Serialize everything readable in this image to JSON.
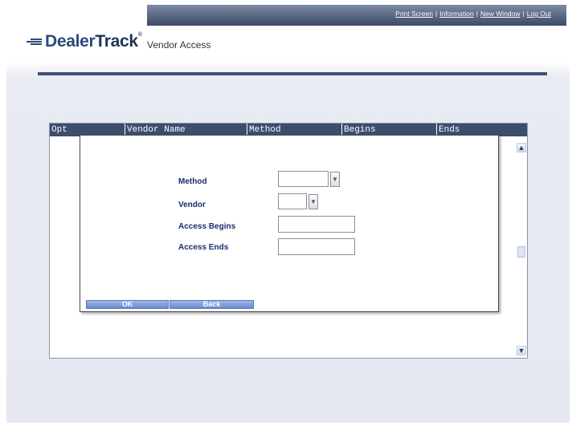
{
  "header": {
    "links": [
      "Print Screen",
      "Information",
      "New Window",
      "Log Out"
    ],
    "separator": "|",
    "brand": {
      "part1": "Dealer",
      "part2": "Track",
      "mark": "®"
    },
    "app_title": "Vendor Access"
  },
  "grid": {
    "columns": [
      "Opt",
      "Vendor Name",
      "Method",
      "Begins",
      "Ends"
    ],
    "scroll_up": "▲",
    "scroll_down": "▼"
  },
  "dialog": {
    "fields": [
      {
        "label": "Method",
        "value": ""
      },
      {
        "label": "Vendor",
        "value": ""
      },
      {
        "label": "Access Begins",
        "value": ""
      },
      {
        "label": "Access Ends",
        "value": ""
      }
    ],
    "dropdown_arrow": "▼",
    "ok_label": "OK",
    "back_label": "Back"
  },
  "colors": {
    "header_bar": "#3b4a66",
    "label_text": "#1e2a6b",
    "button": "#6a8bd0"
  }
}
